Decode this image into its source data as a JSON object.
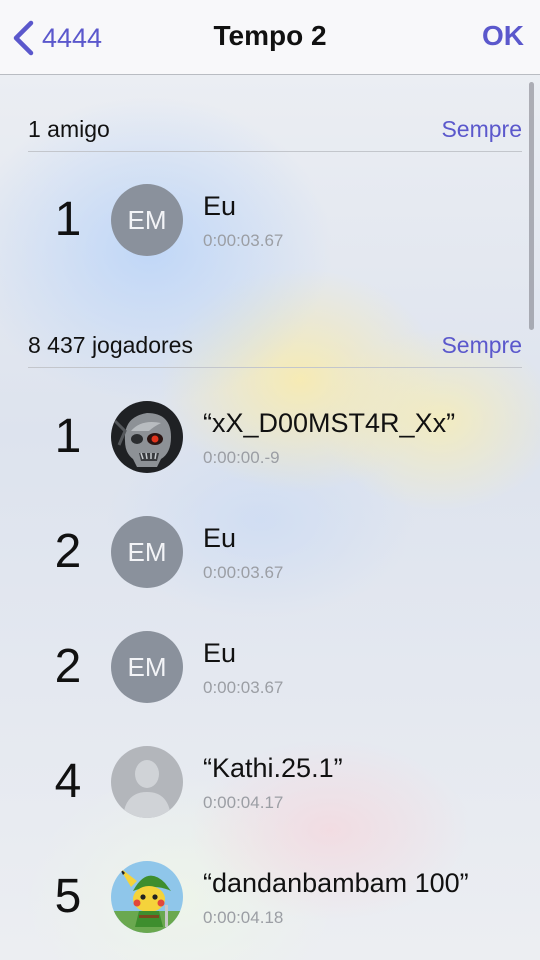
{
  "nav": {
    "back_label": "4444",
    "title": "Tempo 2",
    "done_label": "OK"
  },
  "friends_section": {
    "title": "1 amigo",
    "filter": "Sempre",
    "rows": [
      {
        "rank": "1",
        "avatar": "EM",
        "name": "Eu",
        "time": "0:00:03.67"
      }
    ]
  },
  "players_section": {
    "title": "8 437 jogadores",
    "filter": "Sempre",
    "rows": [
      {
        "rank": "1",
        "avatar_icon": "skull-warrior-avatar",
        "name": "“xX_D00MST4R_Xx”",
        "time": "0:00:00.-9"
      },
      {
        "rank": "2",
        "avatar": "EM",
        "name": "Eu",
        "time": "0:00:03.67"
      },
      {
        "rank": "2",
        "avatar": "EM",
        "name": "Eu",
        "time": "0:00:03.67"
      },
      {
        "rank": "4",
        "avatar_icon": "person-silhouette-avatar",
        "name": "“Kathi.25.1”",
        "time": "0:00:04.17"
      },
      {
        "rank": "5",
        "avatar_icon": "pikachu-link-avatar",
        "name": "“dandanbambam 100”",
        "time": "0:00:04.18"
      }
    ]
  },
  "colors": {
    "accent": "#5b58cc",
    "initials_avatar": "#8a919c",
    "time_text": "#9b9ea4"
  }
}
